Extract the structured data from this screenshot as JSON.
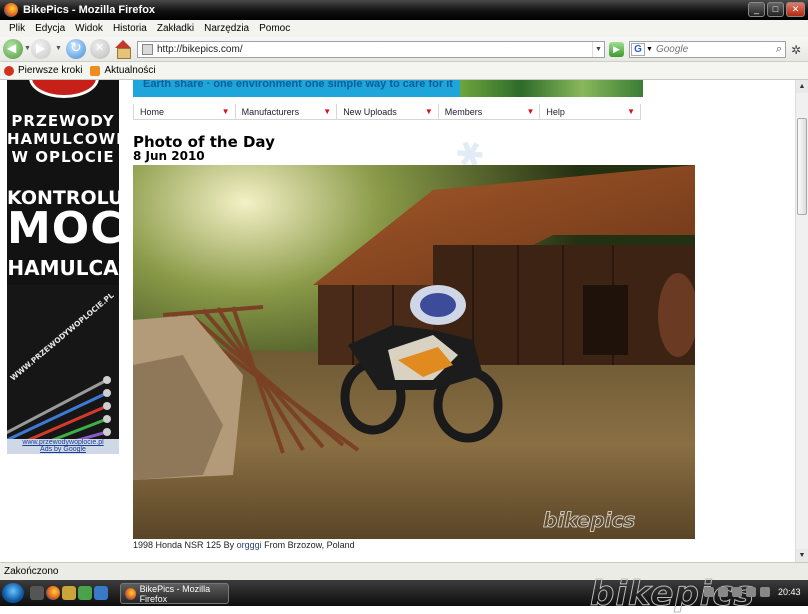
{
  "window": {
    "title": "BikePics - Mozilla Firefox"
  },
  "menu": [
    "Plik",
    "Edycja",
    "Widok",
    "Historia",
    "Zakładki",
    "Narzędzia",
    "Pomoc"
  ],
  "toolbar": {
    "url": "http://bikepics.com/",
    "search_placeholder": "Google"
  },
  "bookmarks": [
    "Pierwsze kroki",
    "Aktualności"
  ],
  "ad": {
    "line1": "PRZEWODY HAMULCOWE W OPLOCIE",
    "line2": "KONTROLUJ",
    "line3": "MOC",
    "line4": "HAMULCA",
    "diag_url": "WWW.PRZEWODYWOPLOCIE.PL",
    "link": "www.przewodywoplocie.pl",
    "ads_by": "Ads by Google"
  },
  "banner": {
    "text": "Earth share · one environment one simple way to care for it"
  },
  "site_nav": [
    "Home",
    "Manufacturers",
    "New Uploads",
    "Members",
    "Help"
  ],
  "photo_of_day": {
    "title": "Photo of the Day",
    "date": "8 Jun 2010",
    "watermark": "bikepics",
    "caption_model": "1998 Honda NSR 125 By",
    "caption_user": "orgggi",
    "caption_from": "From Brzozow, Poland"
  },
  "status": "Zakończono",
  "taskbar": {
    "task_label": "BikePics - Mozilla Firefox",
    "logo": "bikepics",
    "clock": "20:43"
  }
}
